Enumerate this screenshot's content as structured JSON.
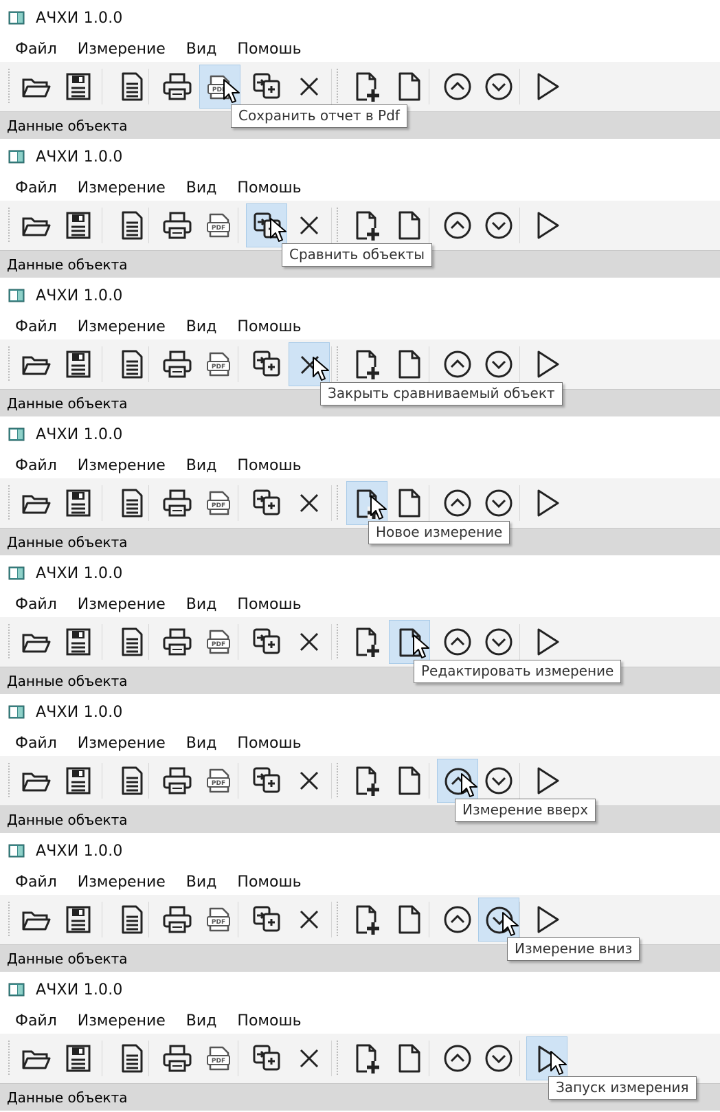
{
  "window": {
    "title": "АЧХИ 1.0.0"
  },
  "menu": {
    "items": [
      "Файл",
      "Измерение",
      "Вид",
      "Помошь"
    ]
  },
  "status": {
    "label": "Данные объекта"
  },
  "toolbar": {
    "buttons": [
      {
        "id": "open",
        "icon": "open-folder-icon"
      },
      {
        "id": "save",
        "icon": "save-disk-icon"
      },
      {
        "id": "report",
        "icon": "report-document-icon"
      },
      {
        "id": "print",
        "icon": "printer-icon"
      },
      {
        "id": "pdf",
        "icon": "pdf-icon"
      },
      {
        "id": "compare",
        "icon": "compare-icon"
      },
      {
        "id": "close-compare",
        "icon": "close-icon"
      },
      {
        "id": "new-measure",
        "icon": "new-document-icon"
      },
      {
        "id": "edit-measure",
        "icon": "edit-document-icon"
      },
      {
        "id": "measure-up",
        "icon": "chevron-up-circle-icon"
      },
      {
        "id": "measure-down",
        "icon": "chevron-down-circle-icon"
      },
      {
        "id": "run-measure",
        "icon": "play-icon"
      }
    ]
  },
  "panels": [
    {
      "hover": "pdf",
      "tooltip": "Сохранить отчет в  Pdf"
    },
    {
      "hover": "compare",
      "tooltip": "Сравнить объекты"
    },
    {
      "hover": "close-compare",
      "tooltip": "Закрыть сравниваемый объект"
    },
    {
      "hover": "new-measure",
      "tooltip": "Новое измерение"
    },
    {
      "hover": "edit-measure",
      "tooltip": "Редактировать измерение"
    },
    {
      "hover": "measure-up",
      "tooltip": "Измерение вверх"
    },
    {
      "hover": "measure-down",
      "tooltip": "Измерение вниз"
    },
    {
      "hover": "run-measure",
      "tooltip": "Запуск измерения"
    }
  ]
}
